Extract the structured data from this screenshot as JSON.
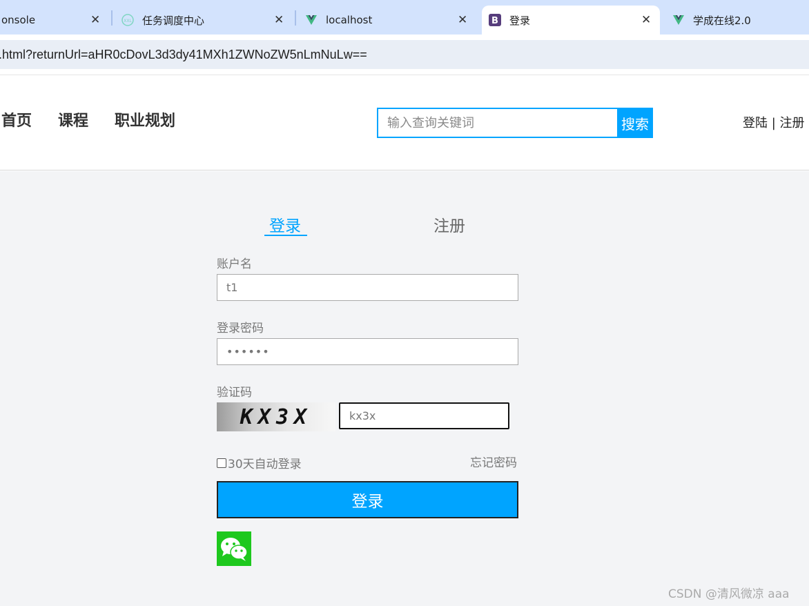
{
  "browser": {
    "tabs": [
      {
        "title": "onsole"
      },
      {
        "title": "任务调度中心"
      },
      {
        "title": "localhost"
      },
      {
        "title": "登录"
      },
      {
        "title": "学成在线2.0"
      }
    ],
    "close_glyph": "✕",
    "address": ".html?returnUrl=aHR0cDovL3d3dy41MXh1ZWNoZW5nLmNuLw=="
  },
  "header": {
    "nav": [
      "首页",
      "课程",
      "职业规划"
    ],
    "search": {
      "placeholder": "输入查询关键词",
      "button": "搜索"
    },
    "login_link": "登陆",
    "divider": "|",
    "register_link": "注册"
  },
  "login_form": {
    "tab_login": "登录",
    "tab_register": "注册",
    "username_label": "账户名",
    "username_value": "t1",
    "password_label": "登录密码",
    "password_value": "••••••",
    "captcha_label": "验证码",
    "captcha_image_text": "KX3X",
    "captcha_value": "kx3x",
    "remember_label": "30天自动登录",
    "forgot_label": "忘记密码",
    "submit_label": "登录"
  },
  "watermark": "CSDN @清风微凉 aaa",
  "colors": {
    "accent": "#00a4ff",
    "wechat": "#1ec81e",
    "background": "#f3f4f6"
  }
}
